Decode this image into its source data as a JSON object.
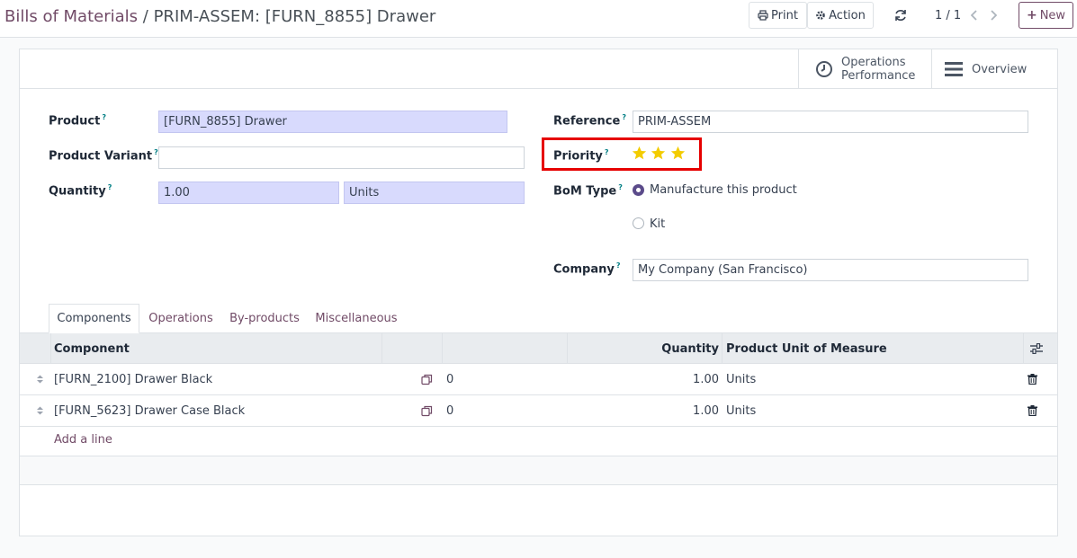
{
  "breadcrumb": {
    "parent": "Bills of Materials",
    "separator": "/",
    "current": "PRIM-ASSEM: [FURN_8855] Drawer"
  },
  "toolbar": {
    "print_label": "Print",
    "action_label": "Action",
    "pager": "1 / 1",
    "new_label": "New"
  },
  "stat_buttons": {
    "operations_performance": [
      "Operations",
      "Performance"
    ],
    "overview": "Overview"
  },
  "form": {
    "product": {
      "label": "Product",
      "help": "?",
      "value": "[FURN_8855] Drawer"
    },
    "product_variant": {
      "label": "Product Variant",
      "help": "?",
      "value": ""
    },
    "quantity": {
      "label": "Quantity",
      "help": "?",
      "value": "1.00",
      "uom": "Units"
    },
    "reference": {
      "label": "Reference",
      "help": "?",
      "value": "PRIM-ASSEM"
    },
    "priority": {
      "label": "Priority",
      "help": "?",
      "stars": 3,
      "max_stars": 3,
      "star_color": "#f3cc00"
    },
    "bom_type": {
      "label": "BoM Type",
      "help": "?",
      "options": [
        "Manufacture this product",
        "Kit"
      ],
      "selected": "Manufacture this product"
    },
    "company": {
      "label": "Company",
      "help": "?",
      "value": "My Company (San Francisco)"
    }
  },
  "tabs": [
    "Components",
    "Operations",
    "By-products",
    "Miscellaneous"
  ],
  "active_tab": "Components",
  "table": {
    "headers": {
      "component": "Component",
      "quantity": "Quantity",
      "uom": "Product Unit of Measure"
    },
    "rows": [
      {
        "component": "[FURN_2100] Drawer Black",
        "count": "0",
        "quantity": "1.00",
        "uom": "Units"
      },
      {
        "component": "[FURN_5623] Drawer Case Black",
        "count": "0",
        "quantity": "1.00",
        "uom": "Units"
      }
    ],
    "add_line": "Add a line"
  },
  "colors": {
    "brand": "#714b67",
    "required_field": "#d8dafd",
    "highlight": "#e60000"
  }
}
